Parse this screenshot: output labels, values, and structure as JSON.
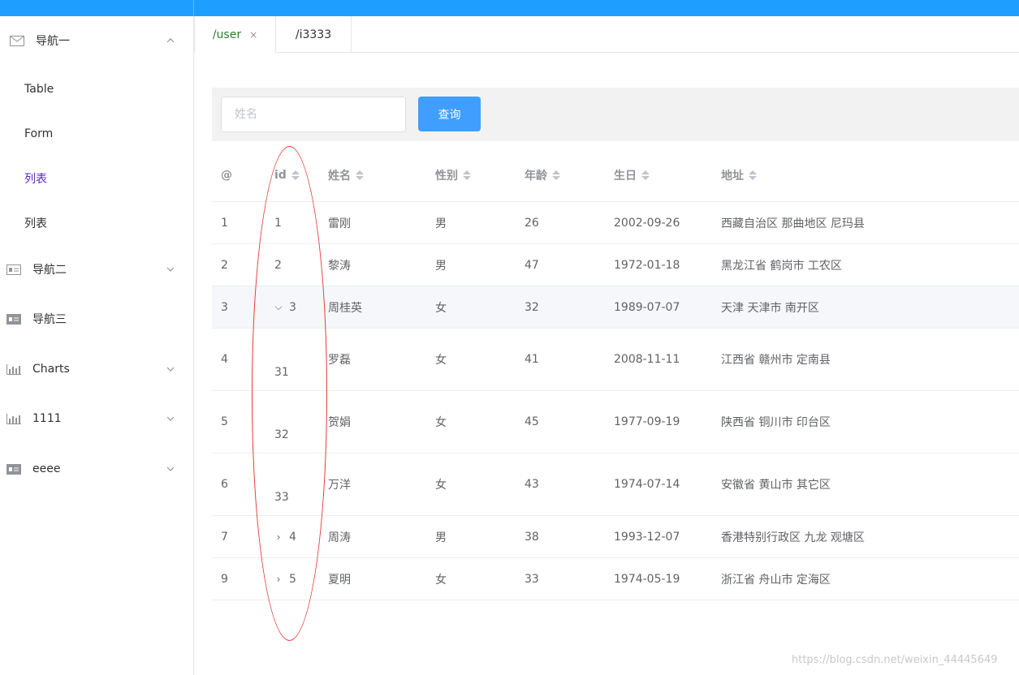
{
  "sidebar": {
    "groups": [
      {
        "label": "导航一",
        "icon": "mail-icon",
        "expanded": true
      },
      {
        "label": "导航二",
        "icon": "id-card-icon",
        "expanded": false
      },
      {
        "label": "导航三",
        "icon": "id-card-icon",
        "expanded": false
      },
      {
        "label": "Charts",
        "icon": "bar-chart-icon",
        "expanded": false
      },
      {
        "label": "1111",
        "icon": "bar-chart-icon",
        "expanded": false
      },
      {
        "label": "eeee",
        "icon": "id-card-icon",
        "expanded": false
      }
    ],
    "sub_items": [
      {
        "label": "Table"
      },
      {
        "label": "Form"
      },
      {
        "label": "列表",
        "active": true
      },
      {
        "label": "列表"
      }
    ]
  },
  "tabs": [
    {
      "label": "/user",
      "active": true,
      "close": "×"
    },
    {
      "label": "/i3333",
      "active": false
    }
  ],
  "search": {
    "placeholder": "姓名",
    "value": "",
    "button_label": "查询"
  },
  "table": {
    "headers": [
      "@",
      "id",
      "姓名",
      "性别",
      "年龄",
      "生日",
      "地址"
    ],
    "rows": [
      {
        "index": "1",
        "id": "1",
        "name": "雷刚",
        "gender": "男",
        "age": "26",
        "birthday": "2002-09-26",
        "address": "西藏自治区 那曲地区 尼玛县"
      },
      {
        "index": "2",
        "id": "2",
        "name": "黎涛",
        "gender": "男",
        "age": "47",
        "birthday": "1972-01-18",
        "address": "黑龙江省 鹤岗市 工农区"
      },
      {
        "index": "3",
        "id": "3",
        "expander": "⌵",
        "name": "周桂英",
        "gender": "女",
        "age": "32",
        "birthday": "1989-07-07",
        "address": "天津 天津市 南开区"
      },
      {
        "index": "4",
        "id": "31",
        "name": "罗磊",
        "gender": "女",
        "age": "41",
        "birthday": "2008-11-11",
        "address": "江西省 赣州市 定南县"
      },
      {
        "index": "5",
        "id": "32",
        "name": "贺娟",
        "gender": "女",
        "age": "45",
        "birthday": "1977-09-19",
        "address": "陕西省 铜川市 印台区"
      },
      {
        "index": "6",
        "id": "33",
        "name": "万洋",
        "gender": "女",
        "age": "43",
        "birthday": "1974-07-14",
        "address": "安徽省 黄山市 其它区"
      },
      {
        "index": "7",
        "id": "4",
        "expander": "›",
        "name": "周涛",
        "gender": "男",
        "age": "38",
        "birthday": "1993-12-07",
        "address": "香港特别行政区 九龙 观塘区"
      },
      {
        "index": "9",
        "id": "5",
        "expander": "›",
        "name": "夏明",
        "gender": "女",
        "age": "33",
        "birthday": "1974-05-19",
        "address": "浙江省 舟山市 定海区"
      }
    ]
  },
  "watermark": "https://blog.csdn.net/weixin_44445649",
  "colors": {
    "topbar": "#1e9fff",
    "primary": "#409eff",
    "annotation": "#e53935",
    "active_menu": "#5b2bbd"
  }
}
